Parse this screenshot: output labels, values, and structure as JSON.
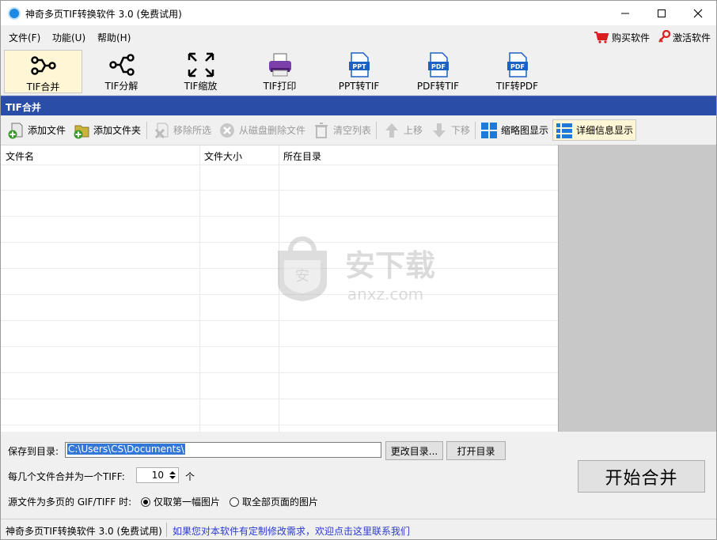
{
  "window": {
    "title": "神奇多页TIF转换软件 3.0 (免费试用)"
  },
  "menu": [
    "文件(F)",
    "功能(U)",
    "帮助(H)"
  ],
  "top_actions": {
    "buy": "购买软件",
    "activate": "激活软件"
  },
  "tools": [
    {
      "label": "TIF合并",
      "icon": "merge-icon",
      "selected": true
    },
    {
      "label": "TIF分解",
      "icon": "split-icon"
    },
    {
      "label": "TIF缩放",
      "icon": "resize-icon"
    },
    {
      "label": "TIF打印",
      "icon": "printer-icon"
    },
    {
      "label": "PPT转TIF",
      "icon": "ppt-file-icon",
      "icon_text": "PPT"
    },
    {
      "label": "PDF转TIF",
      "icon": "pdf-file-icon",
      "icon_text": "PDF"
    },
    {
      "label": "TIF转PDF",
      "icon": "pdf-file-icon",
      "icon_text": "PDF"
    }
  ],
  "section_title": "TIF合并",
  "toolbar": {
    "add_file": "添加文件",
    "add_folder": "添加文件夹",
    "remove_selected": "移除所选",
    "delete_from_disk": "从磁盘删除文件",
    "clear_list": "清空列表",
    "move_up": "上移",
    "move_down": "下移",
    "thumbnail_view": "缩略图显示",
    "detail_view": "详细信息显示"
  },
  "table": {
    "columns": [
      "文件名",
      "文件大小",
      "所在目录"
    ],
    "rows": []
  },
  "watermark": {
    "cn": "安下载",
    "en": "anxz.com",
    "shield": "安"
  },
  "bottom": {
    "save_dir_label": "保存到目录:",
    "save_dir_value": "C:\\Users\\CS\\Documents\\",
    "change_dir": "更改目录...",
    "open_dir": "打开目录",
    "per_tiff_label": "每几个文件合并为一个TIFF:",
    "per_tiff_value": "10",
    "per_tiff_unit": "个",
    "multipage_label": "源文件为多页的 GIF/TIFF 时:",
    "radio_first": "仅取第一幅图片",
    "radio_all": "取全部页面的图片",
    "radio_selected": "first",
    "start": "开始合并"
  },
  "status": {
    "left": "神奇多页TIF转换软件 3.0 (免费试用)",
    "link": "如果您对本软件有定制修改需求，欢迎点击这里联系我们"
  },
  "colors": {
    "section_bar": "#2a4ea8",
    "selection": "#3378d6",
    "link": "#2a3ad0",
    "selected_tool_bg": "#fff6d6"
  }
}
